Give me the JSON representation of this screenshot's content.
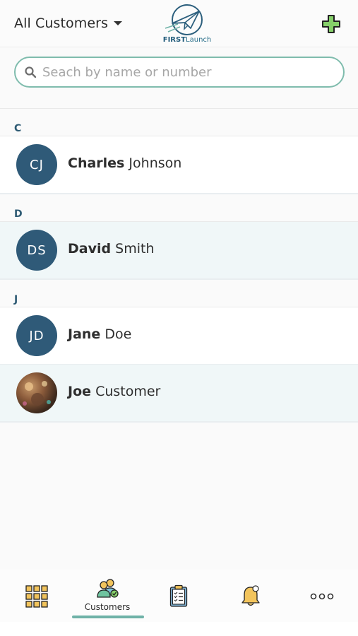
{
  "header": {
    "filter_label": "All Customers",
    "logo_text_bold": "FIRST",
    "logo_text_rest": "Launch"
  },
  "search": {
    "placeholder": "Seach by name or number",
    "value": ""
  },
  "sections": [
    {
      "letter": "C",
      "customers": [
        {
          "initials": "CJ",
          "first": "Charles",
          "last": "Johnson"
        }
      ]
    },
    {
      "letter": "D",
      "customers": [
        {
          "initials": "DS",
          "first": "David",
          "last": "Smith"
        }
      ]
    },
    {
      "letter": "J",
      "customers": [
        {
          "initials": "JD",
          "first": "Jane",
          "last": "Doe"
        },
        {
          "initials": "",
          "first": "Joe",
          "last": "Customer"
        }
      ]
    }
  ],
  "tabbar": {
    "customers_label": "Customers",
    "active_tab": "customers"
  },
  "colors": {
    "avatar": "#2f5a78",
    "accent": "#6fb2a7",
    "add_icon": "#86d06a",
    "selected_row": "#f0f7f8"
  }
}
